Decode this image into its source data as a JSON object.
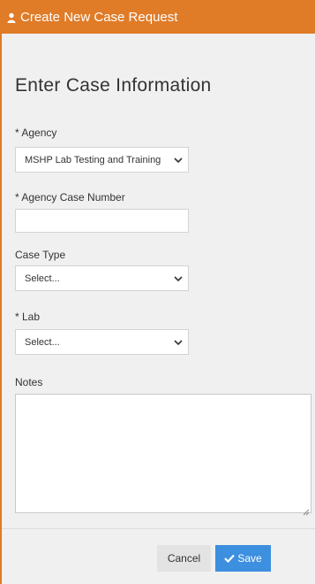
{
  "header": {
    "title": "Create New Case Request",
    "icon": "person-icon",
    "color": "#e07b27"
  },
  "form": {
    "section_title": "Enter Case Information",
    "agency": {
      "label": "* Agency",
      "value": "MSHP Lab Testing and Training"
    },
    "agency_case_number": {
      "label": "* Agency Case Number",
      "value": ""
    },
    "case_type": {
      "label": "Case Type",
      "value": "Select..."
    },
    "lab": {
      "label": "* Lab",
      "value": "Select..."
    },
    "notes": {
      "label": "Notes",
      "value": ""
    }
  },
  "footer": {
    "cancel_label": "Cancel",
    "save_label": "Save",
    "save_color": "#3d8fe0"
  }
}
